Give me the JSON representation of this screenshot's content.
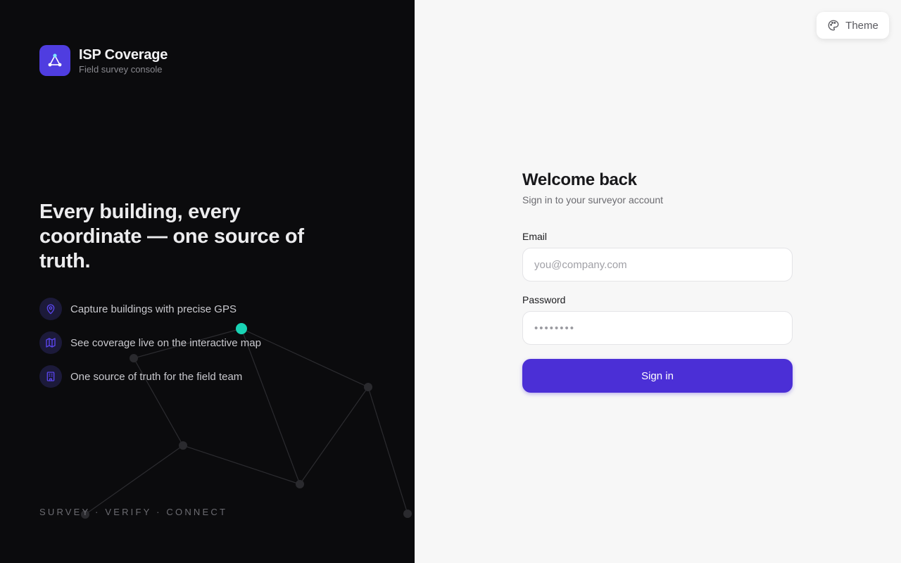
{
  "brand": {
    "title": "ISP Coverage",
    "subtitle": "Field survey console",
    "logo_icon": "network-nodes-icon",
    "accent_color": "#4f3de0"
  },
  "hero": {
    "headline": "Every building, every coordinate — one source of truth."
  },
  "features": [
    {
      "icon": "map-pin-icon",
      "text": "Capture buildings with precise GPS"
    },
    {
      "icon": "map-icon",
      "text": "See coverage live on the interactive map"
    },
    {
      "icon": "building-icon",
      "text": "One source of truth for the field team"
    }
  ],
  "tagline": "SURVEY · VERIFY · CONNECT",
  "theme_button": {
    "label": "Theme",
    "icon": "palette-icon"
  },
  "login": {
    "title": "Welcome back",
    "subtitle": "Sign in to your surveyor account",
    "email_label": "Email",
    "email_placeholder": "you@company.com",
    "password_label": "Password",
    "password_placeholder": "••••••••",
    "submit_label": "Sign in",
    "button_color": "#4b2fd6"
  },
  "network": {
    "highlight_color": "#19d3b4"
  }
}
